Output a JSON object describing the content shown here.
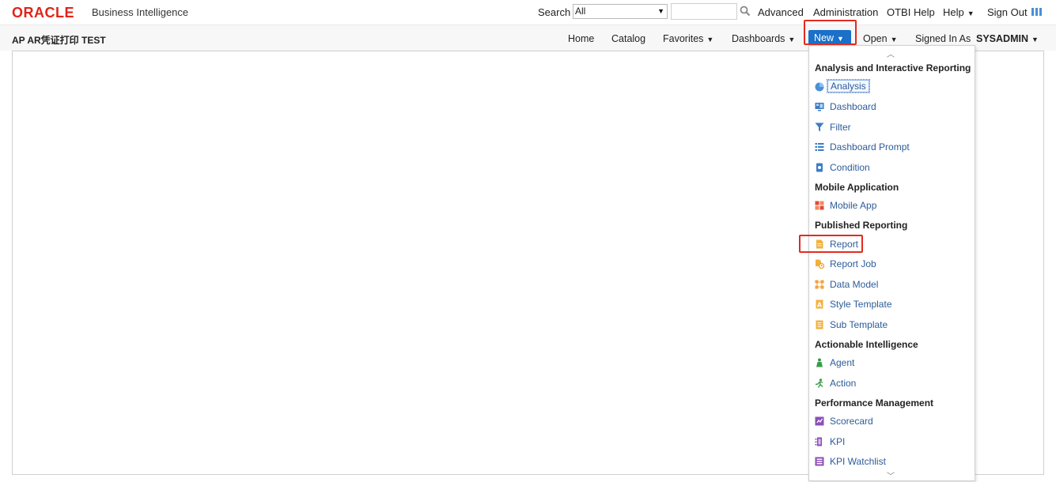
{
  "header": {
    "logo": "ORACLE",
    "product": "Business Intelligence",
    "search_label": "Search",
    "search_scope": "All",
    "links": [
      "Advanced",
      "Administration",
      "OTBI Help",
      "Help",
      "Sign Out"
    ]
  },
  "nav": {
    "page_title": "AP AR凭证打印 TEST",
    "home": "Home",
    "catalog": "Catalog",
    "favorites": "Favorites",
    "dashboards": "Dashboards",
    "new": "New",
    "open": "Open",
    "signed_in_label": "Signed In As",
    "user": "SYSADMIN"
  },
  "menu": {
    "sections": [
      {
        "title": "Analysis and Interactive Reporting",
        "items": [
          {
            "label": "Analysis",
            "icon": "analysis-icon"
          },
          {
            "label": "Dashboard",
            "icon": "dashboard-icon"
          },
          {
            "label": "Filter",
            "icon": "filter-icon"
          },
          {
            "label": "Dashboard Prompt",
            "icon": "dashboard-prompt-icon"
          },
          {
            "label": "Condition",
            "icon": "condition-icon"
          }
        ]
      },
      {
        "title": "Mobile Application",
        "items": [
          {
            "label": "Mobile App",
            "icon": "mobile-app-icon"
          }
        ]
      },
      {
        "title": "Published Reporting",
        "items": [
          {
            "label": "Report",
            "icon": "report-icon"
          },
          {
            "label": "Report Job",
            "icon": "report-job-icon"
          },
          {
            "label": "Data Model",
            "icon": "data-model-icon"
          },
          {
            "label": "Style Template",
            "icon": "style-template-icon"
          },
          {
            "label": "Sub Template",
            "icon": "sub-template-icon"
          }
        ]
      },
      {
        "title": "Actionable Intelligence",
        "items": [
          {
            "label": "Agent",
            "icon": "agent-icon"
          },
          {
            "label": "Action",
            "icon": "action-icon"
          }
        ]
      },
      {
        "title": "Performance Management",
        "items": [
          {
            "label": "Scorecard",
            "icon": "scorecard-icon"
          },
          {
            "label": "KPI",
            "icon": "kpi-icon"
          },
          {
            "label": "KPI Watchlist",
            "icon": "kpi-watchlist-icon"
          }
        ]
      }
    ]
  },
  "colors": {
    "oracle_red": "#e2231a",
    "new_button": "#1b70c9",
    "link_blue": "#2c5c9a",
    "highlight_red": "#e22b1f"
  }
}
